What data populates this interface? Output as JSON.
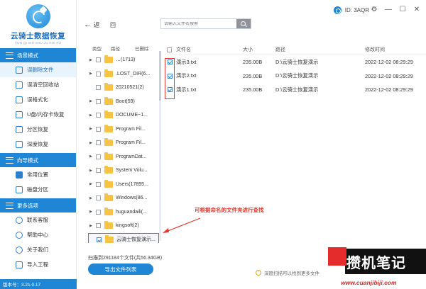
{
  "sidebar": {
    "logo_title": "云骑士数据恢复",
    "logo_subtitle": "YUN QI SHI SHU JU HUI FU",
    "sections": [
      {
        "label": "场景模式",
        "items": [
          "误删除文件",
          "误清空回收站",
          "误格式化",
          "U盘/内存卡恢复",
          "分区恢复",
          "深度恢复"
        ]
      },
      {
        "label": "向导模式",
        "items": [
          "常用位置",
          "磁盘分区"
        ]
      },
      {
        "label": "更多选项",
        "items": [
          "联系客服",
          "帮助中心",
          "关于我们",
          "导入工程"
        ]
      }
    ],
    "version": "版本号：3.21.0.17"
  },
  "header": {
    "back_label": "返",
    "forward_label": "回",
    "search_placeholder": "请输入文件名搜索",
    "id_label": "ID: 3AQR",
    "window_buttons": [
      "⚙",
      "—",
      "☐",
      "✕"
    ]
  },
  "tree": {
    "columns": [
      "类型",
      "路径",
      "已删除"
    ],
    "rows": [
      {
        "label": "…(1713)",
        "expander": "▶",
        "checked": false
      },
      {
        "label": ".LOST_DIR(6...",
        "expander": "▶",
        "checked": false
      },
      {
        "label": "20210521(2)",
        "expander": "",
        "checked": false
      },
      {
        "label": "Boot(59)",
        "expander": "▶",
        "checked": false
      },
      {
        "label": "DOCUME~1...",
        "expander": "▶",
        "checked": false
      },
      {
        "label": "Program Fil...",
        "expander": "▶",
        "checked": false
      },
      {
        "label": "Program Fil...",
        "expander": "▶",
        "checked": false
      },
      {
        "label": "ProgramDat...",
        "expander": "▶",
        "checked": false
      },
      {
        "label": "System Volu...",
        "expander": "▶",
        "checked": false
      },
      {
        "label": "Users(17895...",
        "expander": "▶",
        "checked": false
      },
      {
        "label": "Windows(86...",
        "expander": "▶",
        "checked": false
      },
      {
        "label": "huguandaili(...",
        "expander": "▶",
        "checked": false
      },
      {
        "label": "kingsoft(2)",
        "expander": "▶",
        "checked": false
      },
      {
        "label": "云骑士恢复演示...",
        "expander": "",
        "checked": true
      }
    ]
  },
  "filelist": {
    "columns": [
      "文件名",
      "大小",
      "路径",
      "修改时间"
    ],
    "rows": [
      {
        "name": "演示3.txt",
        "size": "235.00B",
        "path": "D:\\云骑士恢复演示",
        "time": "2022-12-02 08:29:29",
        "checked": true
      },
      {
        "name": "演示2.txt",
        "size": "235.00B",
        "path": "D:\\云骑士恢复演示",
        "time": "2022-12-02 08:29:29",
        "checked": true
      },
      {
        "name": "演示1.txt",
        "size": "235.00B",
        "path": "D:\\云骑士恢复演示",
        "time": "2022-12-02 08:29:29",
        "checked": true
      }
    ]
  },
  "annotation": "可根据命名的文件夹进行查找",
  "footer": {
    "scan_info": "扫描到291184个文件(共56.34GB)",
    "export_label": "导出文件列表",
    "tip_text": "深度扫描可以找到更多文件"
  },
  "watermark": {
    "text": "攒机笔记",
    "url": "www.cuanjibiji.com"
  },
  "colors": {
    "accent": "#1f86d6",
    "annotation_red": "#e23a32",
    "folder": "#f6c344"
  }
}
